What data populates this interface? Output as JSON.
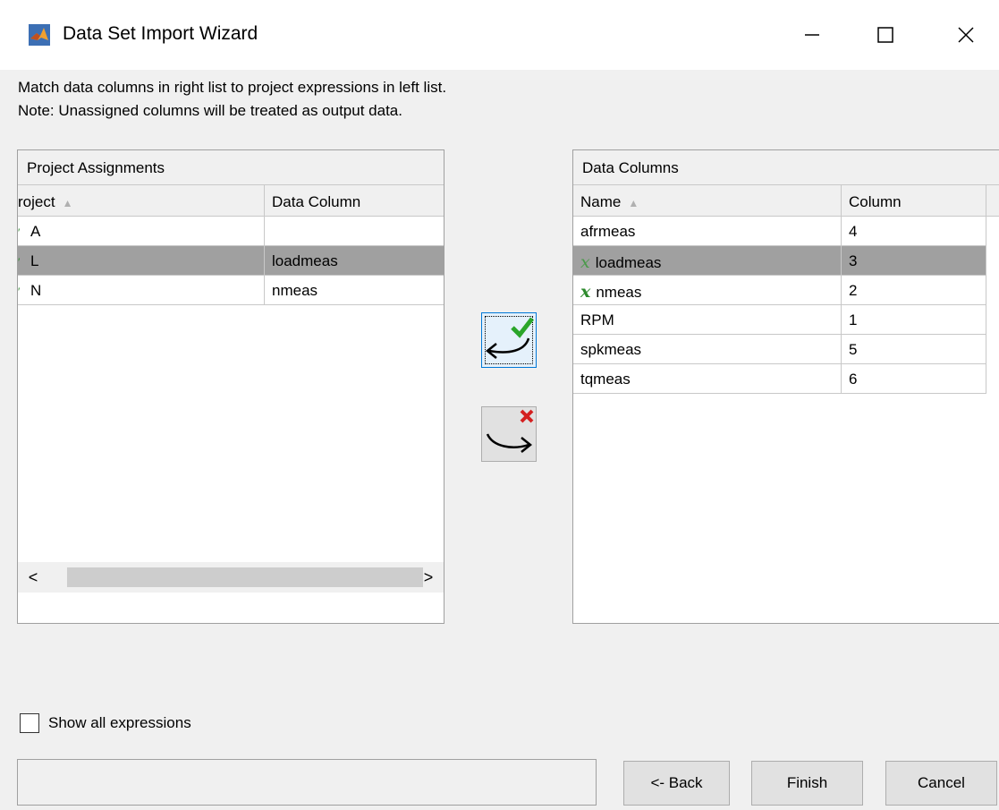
{
  "window": {
    "title": "Data Set Import Wizard",
    "icon": "matlab-logo-icon",
    "controls": [
      "minimize-icon",
      "maximize-icon",
      "close-icon"
    ]
  },
  "instructions": {
    "line1": "Match data columns in right list to project expressions in left list.",
    "line2": "Note: Unassigned columns will be treated as output data."
  },
  "project_assignments": {
    "title": "Project Assignments",
    "columns": [
      "roject",
      "Data Column"
    ],
    "rows": [
      {
        "project": "A",
        "data_column": "",
        "selected": false
      },
      {
        "project": "L",
        "data_column": "loadmeas",
        "selected": true
      },
      {
        "project": "N",
        "data_column": "nmeas",
        "selected": false
      }
    ],
    "scroll_left": "<",
    "scroll_right": ">"
  },
  "data_columns": {
    "title": "Data Columns",
    "columns": [
      "Name",
      "Column"
    ],
    "rows": [
      {
        "name": "afrmeas",
        "column": "4",
        "assigned": false,
        "selected": false
      },
      {
        "name": "loadmeas",
        "column": "3",
        "assigned": true,
        "selected": true
      },
      {
        "name": "nmeas",
        "column": "2",
        "assigned": true,
        "selected": false
      },
      {
        "name": "RPM",
        "column": "1",
        "assigned": false,
        "selected": false
      },
      {
        "name": "spkmeas",
        "column": "5",
        "assigned": false,
        "selected": false
      },
      {
        "name": "tqmeas",
        "column": "6",
        "assigned": false,
        "selected": false
      }
    ],
    "assigned_marker": "x"
  },
  "actions": {
    "assign_icon": "assign-arrow-check-icon",
    "unassign_icon": "unassign-arrow-cross-icon"
  },
  "footer": {
    "show_all_label": "Show all expressions",
    "show_all_checked": false,
    "status_text": "",
    "back_label": "<- Back",
    "finish_label": "Finish",
    "cancel_label": "Cancel"
  },
  "colors": {
    "selected_row": "#a0a0a0",
    "assigned_marker": "#2d8a2d",
    "focus_button": "#e5f1fb"
  }
}
